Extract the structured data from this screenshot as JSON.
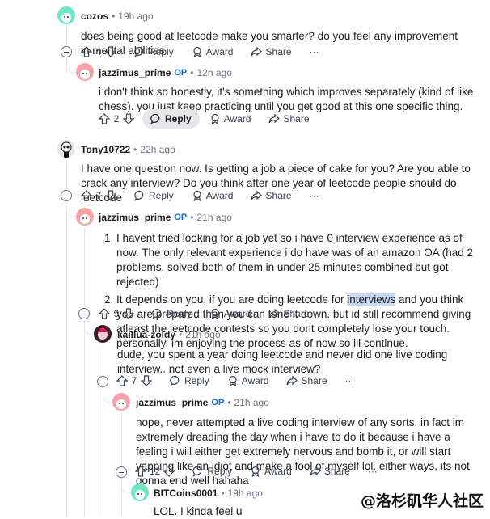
{
  "comments": [
    {
      "user": "cozos",
      "op": "",
      "dot": "•",
      "time": "19h ago",
      "text": "does being good at leetcode make you smarter? do you feel any improvement in mental abilities",
      "votes": "4"
    },
    {
      "user": "jazzimus_prime",
      "op": "OP",
      "dot": "•",
      "time": "12h ago",
      "text": "i don't think so honestly, it's something which improves separately (kind of like chess). you just keep practicing until you get good at this one specific thing.",
      "votes": "2"
    },
    {
      "user": "Tony10722",
      "op": "",
      "dot": "•",
      "time": "22h ago",
      "text": "I have one question now. Is getting a job a piece of cake for you? Are you able to crack any interview? Do you think after one year of leetcode people should do leetcode",
      "votes": "7"
    },
    {
      "user": "jazzimus_prime",
      "op": "OP",
      "dot": "•",
      "time": "21h ago",
      "list": [
        "I havent tried looking for a job yet so i have 0 interview experience as of now. The only relevant experience i do have was of an amazon OA (had 2 problems, solved both of them in under 25 minutes combined but got rejected)",
        {
          "pre": "It depends on you, if you are doing leetcode for ",
          "highlight": "interviews",
          "post": " and you think you are prepared then you can tone it down. but id still recommend giving atleast the leetcode contests so you dont completely lose your touch. personally, im enjoying the process as of now so ill continue."
        }
      ],
      "votes": "9"
    },
    {
      "user": "kaillua-zoldy",
      "op": "",
      "dot": "•",
      "time": "21h ago",
      "text": "dude, you spent a year doing leetcode and never did one live coding interview.. not even a live mock interview?",
      "votes": "7"
    },
    {
      "user": "jazzimus_prime",
      "op": "OP",
      "dot": "•",
      "time": "21h ago",
      "text": "nope, never attempted a live coding interview of any sorts. in fact im extremely dreading the day when i have to do it because i have a feeling i will either get extremely nervous and bomb it, or will start yapping like an idiot and make a fool of myself lol. either ways, its not gonna end well hahaha",
      "votes": "12"
    },
    {
      "user": "BITCoins0001",
      "op": "",
      "dot": "•",
      "time": "19h ago",
      "text": "LOL. I kinda feel u"
    }
  ],
  "actions": {
    "reply": "Reply",
    "award": "Award",
    "share": "Share",
    "more": "···"
  },
  "watermark": "@洛杉矶华人社区",
  "colors": {
    "op": "#0a66d6",
    "thread": "#e5e7eb",
    "highlight": "#c6d9f6"
  }
}
